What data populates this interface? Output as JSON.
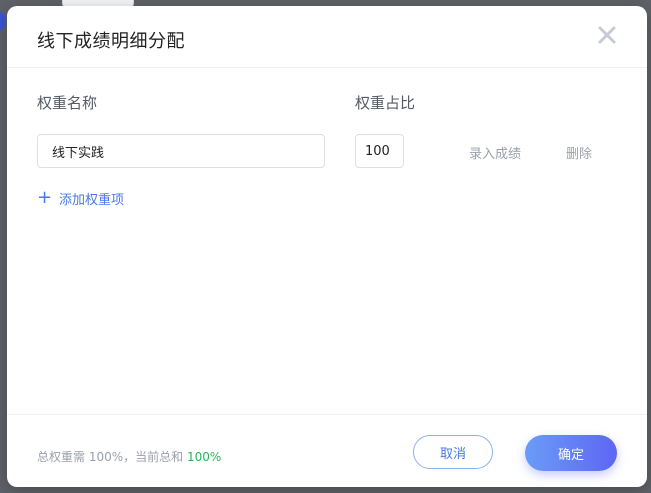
{
  "dialog": {
    "title": "线下成绩明细分配",
    "close_icon": "close-icon"
  },
  "columns": {
    "name_label": "权重名称",
    "ratio_label": "权重占比"
  },
  "rows": [
    {
      "name": "线下实践",
      "ratio": "100",
      "enter_score_label": "录入成绩",
      "delete_label": "删除"
    }
  ],
  "add_item": {
    "icon": "plus-icon",
    "label": "添加权重项"
  },
  "footer": {
    "note_prefix": "总权重需 100%，当前总和",
    "current_total": "100%",
    "cancel_label": "取消",
    "ok_label": "确定"
  },
  "colors": {
    "accent": "#4a78e8",
    "success": "#2bb35a",
    "primary_gradient_start": "#6a9cf7",
    "primary_gradient_end": "#5e66f4"
  }
}
